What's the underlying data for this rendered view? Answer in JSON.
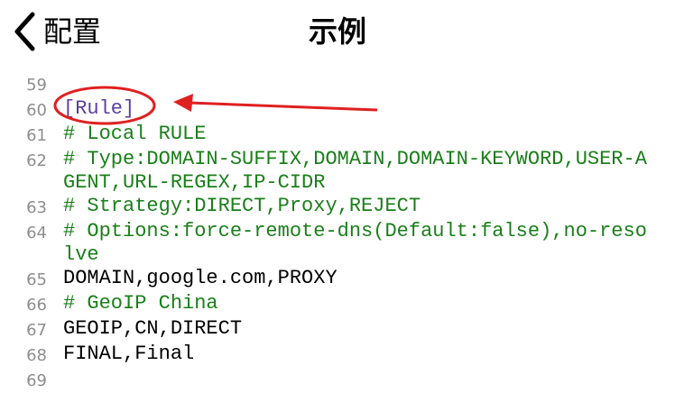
{
  "nav": {
    "back_label": "配置",
    "title": "示例"
  },
  "code": {
    "lines": [
      {
        "num": "59",
        "text": ""
      },
      {
        "num": "60",
        "text": "[Rule]"
      },
      {
        "num": "61",
        "text": "# Local RULE"
      },
      {
        "num": "62",
        "text": "# Type:DOMAIN-SUFFIX,DOMAIN,DOMAIN-KEYWORD,USER-AGENT,URL-REGEX,IP-CIDR"
      },
      {
        "num": "63",
        "text": "# Strategy:DIRECT,Proxy,REJECT"
      },
      {
        "num": "64",
        "text": "# Options:force-remote-dns(Default:false),no-resolve"
      },
      {
        "num": "65",
        "text": "DOMAIN,google.com,PROXY"
      },
      {
        "num": "66",
        "text": "# GeoIP China"
      },
      {
        "num": "67",
        "text": "GEOIP,CN,DIRECT"
      },
      {
        "num": "68",
        "text": "FINAL,Final"
      },
      {
        "num": "69",
        "text": ""
      }
    ]
  },
  "colors": {
    "comment": "#1a7f1a",
    "section": "#5a3fa0",
    "plain": "#000000",
    "line_number": "#8e8e8e",
    "annotation": "#e02020"
  }
}
